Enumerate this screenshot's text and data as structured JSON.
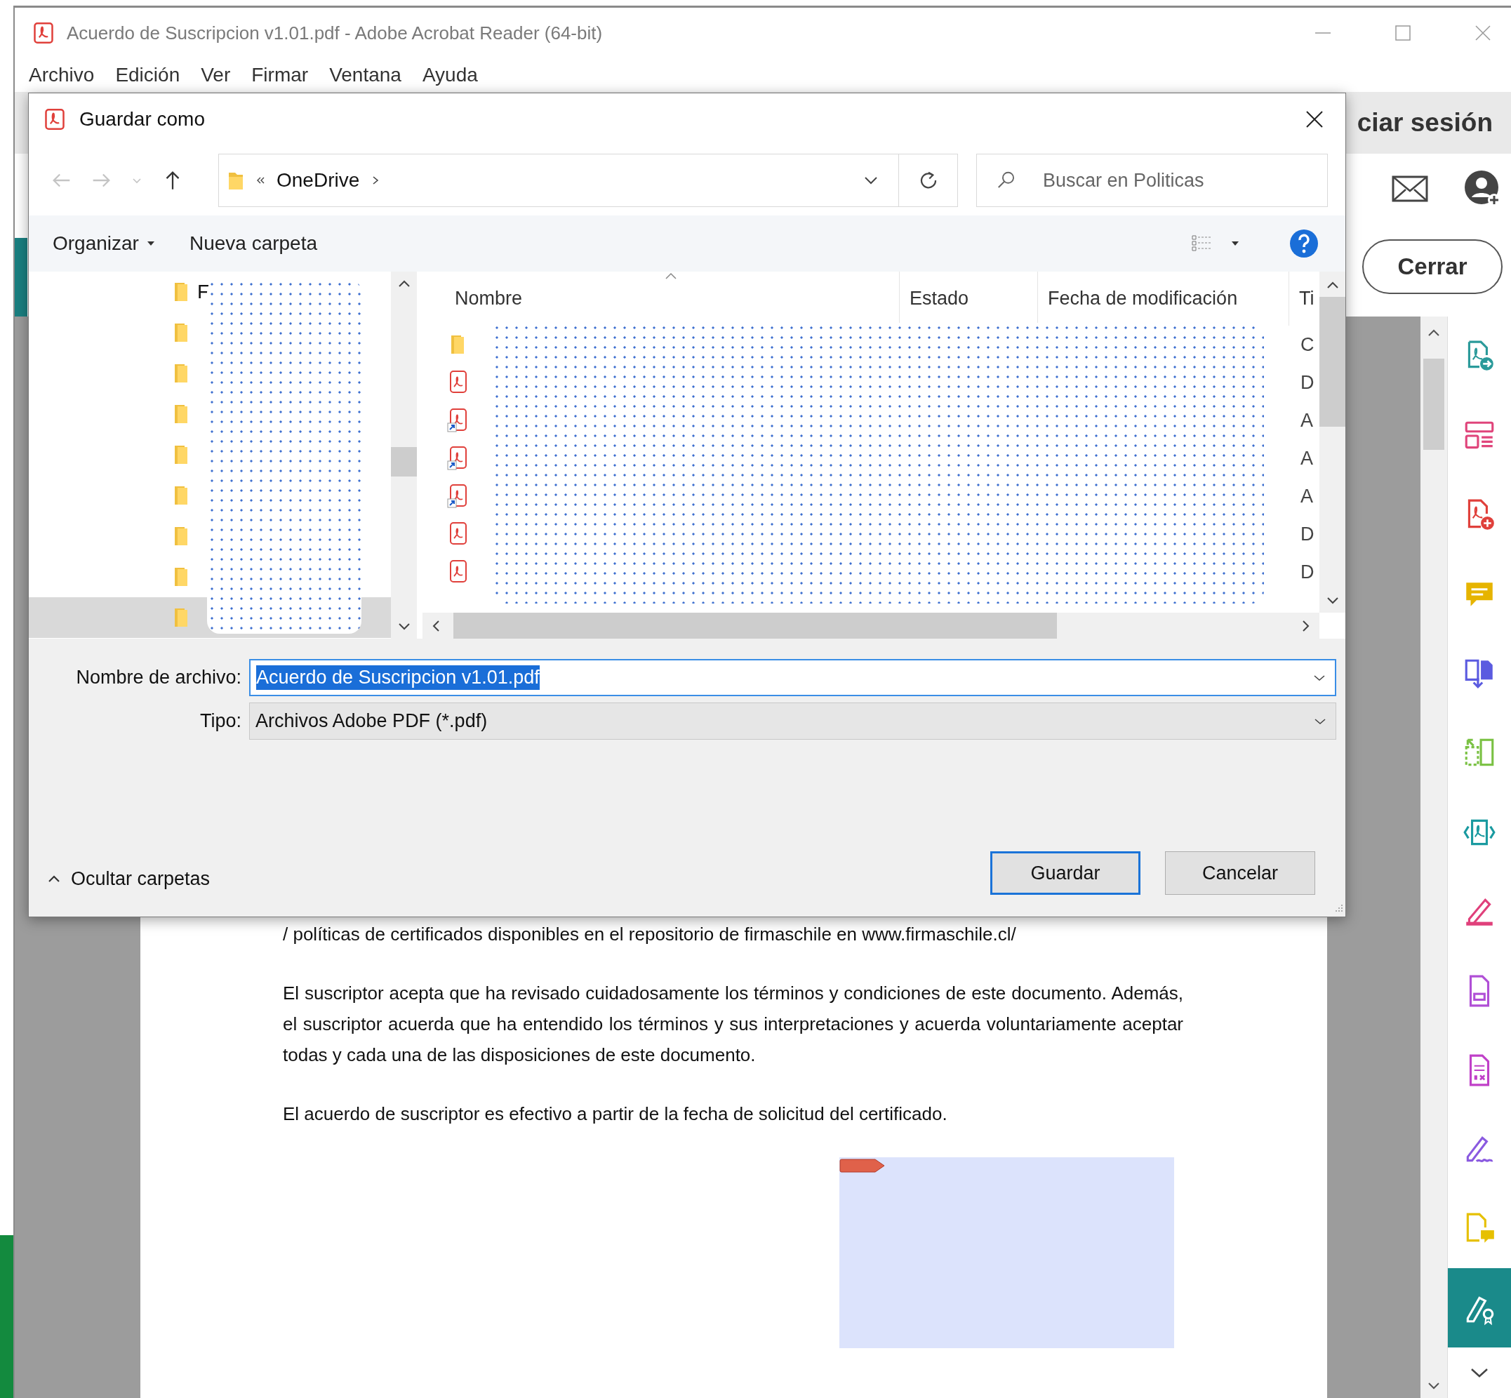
{
  "window": {
    "title": "Acuerdo de Suscripcion v1.01.pdf - Adobe Acrobat Reader (64-bit)"
  },
  "menu": [
    "Archivo",
    "Edición",
    "Ver",
    "Firmar",
    "Ventana",
    "Ayuda"
  ],
  "header": {
    "sign_in": "ciar sesión",
    "close_button": "Cerrar"
  },
  "document": {
    "paragraphs": [
      "/ políticas de certificados disponibles en el repositorio de firmaschile en www.firmaschile.cl/",
      "El suscriptor acepta que ha revisado cuidadosamente los términos y condiciones de este documento. Además, el suscriptor acuerda que ha entendido los términos y sus interpretaciones y acuerda voluntariamente aceptar todas y cada una de las disposiciones de este documento.",
      "El   acuerdo de suscriptor es efectivo a partir de la fecha de solicitud del certificado."
    ]
  },
  "tools_panel": {
    "tools": [
      {
        "kind": "export",
        "selected": false
      },
      {
        "kind": "organize",
        "selected": false
      },
      {
        "kind": "create",
        "selected": false
      },
      {
        "kind": "comment",
        "selected": false
      },
      {
        "kind": "combine",
        "selected": false
      },
      {
        "kind": "pages",
        "selected": false
      },
      {
        "kind": "scan",
        "selected": false
      },
      {
        "kind": "fill",
        "selected": false
      },
      {
        "kind": "protect",
        "selected": false
      },
      {
        "kind": "redact",
        "selected": false
      },
      {
        "kind": "sign",
        "selected": false
      },
      {
        "kind": "send",
        "selected": false
      },
      {
        "kind": "cert",
        "selected": true
      }
    ]
  },
  "dialog": {
    "title": "Guardar como",
    "nav_buttons": [
      {
        "kind": "back",
        "disabled": true
      },
      {
        "kind": "forward",
        "disabled": true
      },
      {
        "kind": "recent",
        "disabled": true
      },
      {
        "kind": "up",
        "disabled": false
      }
    ],
    "path": [
      "OneDrive"
    ],
    "search": {
      "placeholder": "Buscar en Politicas"
    },
    "toolbar": {
      "organize": "Organizar",
      "new_folder": "Nueva carpeta"
    },
    "nav_items": [
      {
        "label": "F",
        "selected": false
      },
      {
        "selected": false
      },
      {
        "selected": false
      },
      {
        "selected": false
      },
      {
        "selected": false
      },
      {
        "selected": false
      },
      {
        "selected": false
      },
      {
        "selected": false
      },
      {
        "selected": true
      }
    ],
    "columns": [
      "Nombre",
      "Estado",
      "Fecha de modificación",
      "Ti"
    ],
    "files": [
      {
        "kind": "folder",
        "type": "C"
      },
      {
        "kind": "pdf",
        "type": "D"
      },
      {
        "kind": "pdf_shortcut",
        "type": "A"
      },
      {
        "kind": "pdf_shortcut",
        "type": "A"
      },
      {
        "kind": "pdf_shortcut",
        "type": "A"
      },
      {
        "kind": "pdf",
        "type": "D"
      },
      {
        "kind": "pdf",
        "type": "D"
      }
    ],
    "file_name": {
      "label": "Nombre de archivo:",
      "value": "Acuerdo de Suscripcion v1.01.pdf",
      "selected": true
    },
    "file_type": {
      "label": "Tipo:",
      "value": "Archivos Adobe PDF (*.pdf)"
    },
    "hide_folders": "Ocultar carpetas",
    "buttons": [
      {
        "label": "Guardar",
        "default": true
      },
      {
        "label": "Cancelar",
        "default": false
      }
    ]
  }
}
